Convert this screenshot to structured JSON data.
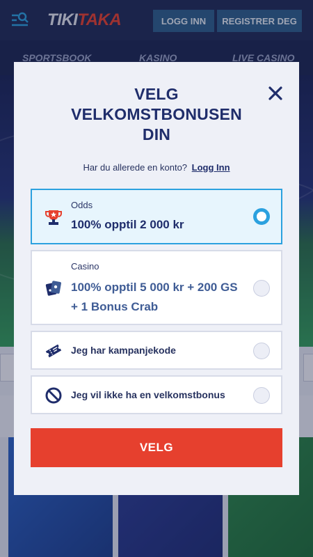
{
  "header": {
    "logo_part1": "TIKI",
    "logo_part2": "TAKA",
    "login_label": "LOGG INN",
    "register_label": "REGISTRER DEG"
  },
  "nav": {
    "items": [
      "SPORTSBOOK",
      "KASINO",
      "LIVE CASINO"
    ]
  },
  "modal": {
    "title_lines": [
      "VELG",
      "VELKOMSTBONUSEN",
      "DIN"
    ],
    "subtitle": "Har du allerede en konto?",
    "login_link": "Logg Inn",
    "options": [
      {
        "category": "Odds",
        "text": "100% opptil 2 000 kr",
        "icon": "trophy-icon",
        "selected": true
      },
      {
        "category": "Casino",
        "text_line1": "100% opptil 5 000 kr + 200 GS",
        "text_line2": "+ 1 Bonus Crab",
        "icon": "cards-icon",
        "selected": false
      },
      {
        "text": "Jeg har kampanjekode",
        "icon": "ticket-icon",
        "selected": false
      },
      {
        "text": "Jeg vil ikke ha en velkomstbonus",
        "icon": "no-sign-icon",
        "selected": false
      }
    ],
    "submit_label": "VELG"
  },
  "colors": {
    "accent_red": "#e6402e",
    "accent_blue": "#2ba1df",
    "navy": "#1f2d6b",
    "header_button": "#2d5f8a"
  }
}
